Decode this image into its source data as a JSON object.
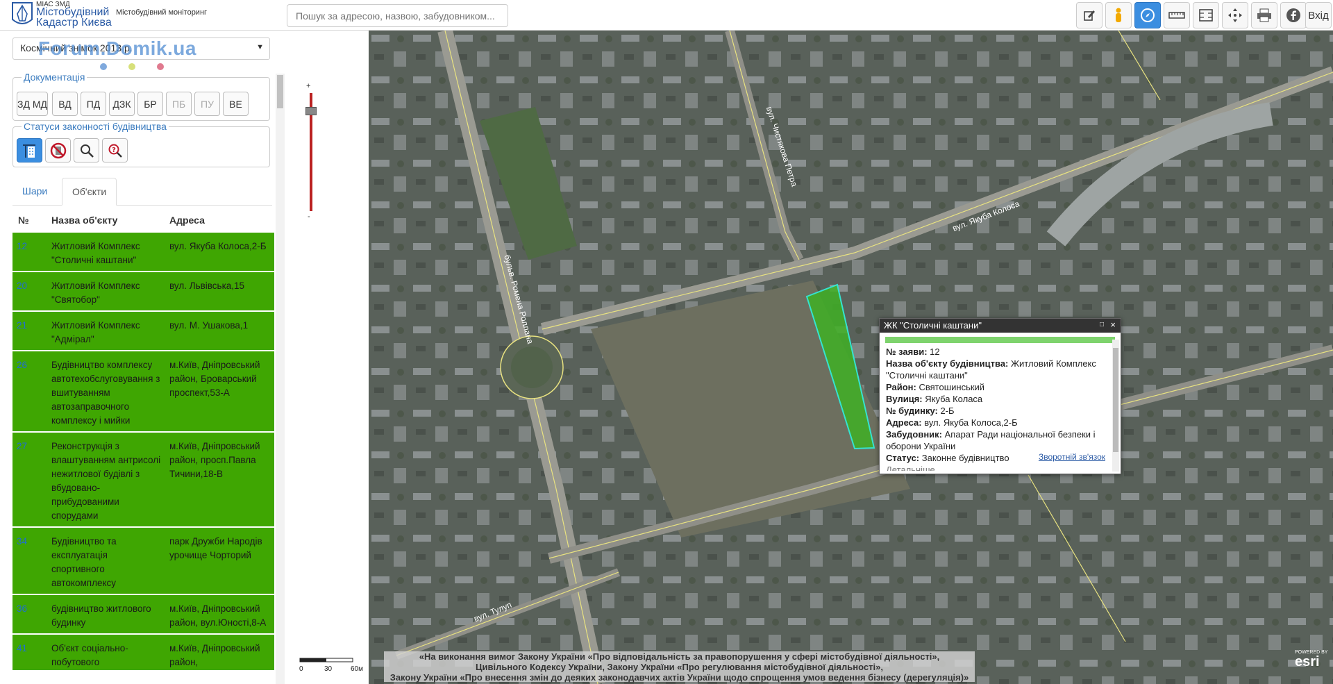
{
  "header": {
    "logo_small": "МІАС ЗМД",
    "logo_title_1": "Містобудівний",
    "logo_title_2": "Кадастр Києва",
    "subtitle": "Містобудівний моніторинг",
    "search_placeholder": "Пошук за адресою, назвою, забудовником...",
    "exit_label": "Вхід"
  },
  "sidebar": {
    "basemap_value": "Космічний знімок 2013 р.",
    "watermark": "Forum.Domik.ua",
    "dot_colors": [
      "#7fa9dd",
      "#d7e07a",
      "#e07a8f"
    ],
    "docs": {
      "title": "Документація",
      "buttons": [
        "ЗД МД",
        "ВД",
        "ПД",
        "ДЗК",
        "БР",
        "ПБ",
        "ПУ",
        "ВЕ"
      ]
    },
    "statuses": {
      "title": "Статуси законності будівництва"
    },
    "tabs": [
      "Шари",
      "Об'єкти"
    ],
    "columns": [
      "№",
      "Назва об'єкту",
      "Адреса"
    ],
    "rows": [
      {
        "num": "12",
        "name": "Житловий Комплекс \"Столичні каштани\"",
        "address": "вул. Якуба Колоса,2-Б"
      },
      {
        "num": "20",
        "name": "Житловий Комплекс \"Святобор\"",
        "address": "вул. Львівська,15"
      },
      {
        "num": "21",
        "name": "Житловий Комплекс \"Адмірал\"",
        "address": "вул. М. Ушакова,1"
      },
      {
        "num": "26",
        "name": "Будівництво комплексу автотехобслуговування з вшитуванням автозаправочного комплексу і мийки",
        "address": "м.Київ, Дніпровський район, Броварський проспект,53-А"
      },
      {
        "num": "27",
        "name": "Реконструкція з влаштуванням антрисолі нежитлової будівлі з вбудовано-прибудованими спорудами",
        "address": "м.Київ, Дніпровський район, просп.Павла Тичини,18-В"
      },
      {
        "num": "34",
        "name": "Будівництво та експлуатація спортивного автокомплексу",
        "address": "парк Дружби Народів урочище Чорторий"
      },
      {
        "num": "36",
        "name": "будівництво житлового будинку",
        "address": "м.Київ, Дніпровський район, вул.Юності,8-А"
      },
      {
        "num": "41",
        "name": "Об'єкт соціально-побутового",
        "address": "м.Київ, Дніпровський район,"
      }
    ],
    "zoom_plus": "+",
    "zoom_minus": "-"
  },
  "map": {
    "streets": [
      "вул. Якуба Колоса",
      "бульв. Ромена Роллана",
      "вул. Чистякова Петра",
      "вул. Тулуп"
    ],
    "popup": {
      "title": "ЖК \"Столичні каштани\"",
      "fields": [
        {
          "label": "№ заяви:",
          "value": "12"
        },
        {
          "label": "Назва об'єкту будівництва:",
          "value": "Житловий Комплекс \"Столичні каштани\""
        },
        {
          "label": "Район:",
          "value": "Святошинський"
        },
        {
          "label": "Вулиця:",
          "value": "Якуба Коласа"
        },
        {
          "label": "№ будинку:",
          "value": "2-Б"
        },
        {
          "label": "Адреса:",
          "value": "вул. Якуба Колоса,2-Б"
        },
        {
          "label": "Забудовник:",
          "value": "Апарат Ради національної безпеки і оборони України"
        },
        {
          "label": "Статус:",
          "value": "Законне будівництво"
        }
      ],
      "more": "Детальніше",
      "feedback": "Зворотній зв'язок"
    },
    "legal_lines": [
      "«На виконання вимог Закону України «Про відповідальність за правопорушення у сфері містобудівної діяльності»,",
      "Цивільного Кодексу України, Закону України «Про регулювання містобудівної діяльності»,",
      "Закону України «Про внесення змін до деяких законодавчих актів України щодо спрощення умов ведення бізнесу (дерегуляція)»"
    ],
    "scale_labels": [
      "0",
      "30",
      "60м"
    ],
    "esri_powered": "POWERED BY",
    "esri_label": "esri"
  }
}
